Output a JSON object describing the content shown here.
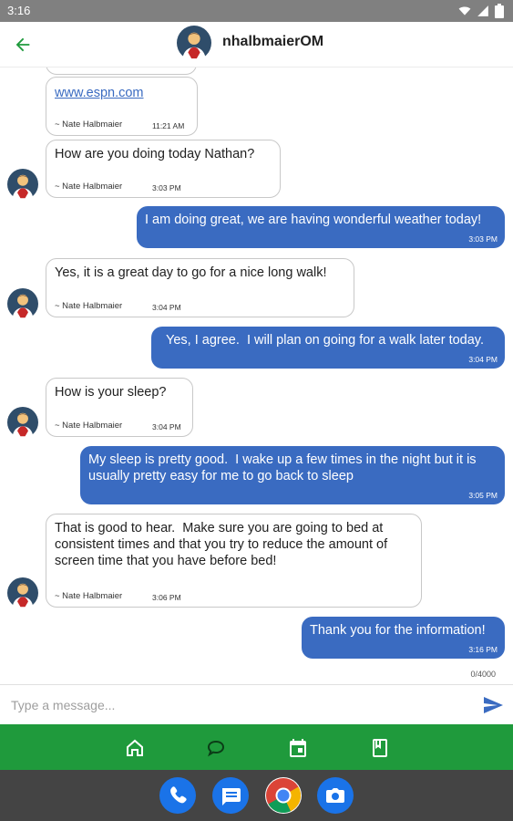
{
  "status_bar": {
    "time": "3:16",
    "icons": [
      "wifi-icon",
      "signal-icon",
      "battery-icon"
    ]
  },
  "header": {
    "title": "nhalbmaierOM",
    "back_icon": "arrow-back-icon"
  },
  "messages": [
    {
      "direction": "incoming",
      "link": "www.espn.com",
      "sender": "~ Nate Halbmaier",
      "time": "11:21 AM"
    },
    {
      "direction": "incoming",
      "text": "How are you doing today Nathan?",
      "sender": "~ Nate Halbmaier",
      "time": "3:03 PM"
    },
    {
      "direction": "outgoing",
      "text": "I am doing great, we are having wonderful weather today!",
      "time": "3:03 PM"
    },
    {
      "direction": "incoming",
      "text": "Yes, it is a great day to go for a nice long walk!",
      "sender": "~ Nate Halbmaier",
      "time": "3:04 PM"
    },
    {
      "direction": "outgoing",
      "text": "Yes, I agree.  I will plan on going for a walk later today.",
      "time": "3:04 PM"
    },
    {
      "direction": "incoming",
      "text": "How is your sleep?",
      "sender": "~ Nate Halbmaier",
      "time": "3:04 PM"
    },
    {
      "direction": "outgoing",
      "text": "My sleep is pretty good.  I wake up a few times in the night but it is\nusually pretty easy for me to go back to sleep",
      "time": "3:05 PM"
    },
    {
      "direction": "incoming",
      "text": "That is good to hear.  Make sure you are going to bed at\nconsistent times and that you try to reduce the amount of\nscreen time that you have before bed!",
      "sender": "~ Nate Halbmaier",
      "time": "3:06 PM"
    },
    {
      "direction": "outgoing",
      "text": "Thank you for the information!",
      "time": "3:16 PM"
    }
  ],
  "composer": {
    "placeholder": "Type a message...",
    "counter": "0/4000",
    "send_icon": "send-icon"
  },
  "bottom_nav": {
    "items": [
      "home-icon",
      "chat-icon",
      "calendar-icon",
      "book-icon"
    ],
    "active": "chat-icon"
  },
  "dock": {
    "apps": [
      "phone-icon",
      "messages-icon",
      "chrome-icon",
      "camera-icon"
    ]
  },
  "colors": {
    "accent_green": "#1f9a3c",
    "outgoing_bubble": "#3a6bc1",
    "status_bar": "#808080",
    "dock": "#444444"
  }
}
